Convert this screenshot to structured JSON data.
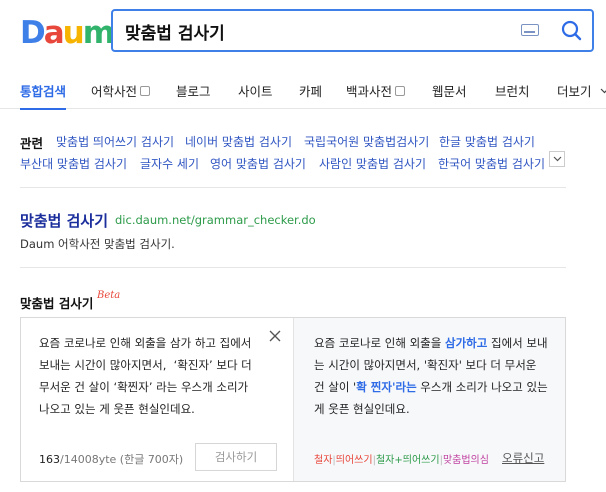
{
  "header": {
    "logo": {
      "d": "D",
      "a": "a",
      "u": "u",
      "m": "m"
    },
    "search_value": "맞춤법 검사기"
  },
  "tabs": [
    {
      "label": "통합검색",
      "active": true
    },
    {
      "label": "어학사전",
      "checkbox": true
    },
    {
      "label": "블로그"
    },
    {
      "label": "사이트"
    },
    {
      "label": "카페"
    },
    {
      "label": "백과사전",
      "checkbox": true
    },
    {
      "label": "웹문서"
    },
    {
      "label": "브런치"
    },
    {
      "label": "더보기"
    }
  ],
  "related": {
    "label": "관련",
    "row1": [
      "맞춤법 띄어쓰기 검사기",
      "네이버 맞춤법 검사기",
      "국립국어원 맞춤법검사기",
      "한글 맞춤법 검사기"
    ],
    "row2": [
      "부산대 맞춤법 검사기",
      "글자수 세기",
      "영어 맞춤법 검사기",
      "사람인 맞춤법 검사기",
      "한국어 맞춤법 검사기"
    ]
  },
  "result": {
    "title": "맞춤법 검사기",
    "url": "dic.daum.net/grammar_checker.do",
    "desc": "Daum 어학사전 맞춤법 검사기."
  },
  "checker": {
    "title": "맞춤법 검사기",
    "beta": "Beta",
    "input_text": "요즘 코로나로 인해 외출을 삼가 하고 집에서 보내는 시간이 많아지면서,  ‘확진자’ 보다 더 무서운 건 살이 ‘확찐자’ 라는 우스개 소리가 나오고 있는 게 웃픈 현실인데요.",
    "count": "163",
    "count_rest": "/14008yte (한글 700자)",
    "check_button": "검사하기",
    "output": {
      "p1": "요즘 코로나로 인해 외출을 ",
      "hl1": "삼가하고",
      "p2": " 집에서 보내는 시간이 많아지면서, '확진자' 보다 더 무서운 건 살이 '",
      "hl2": "확 찐자'라는",
      "p3": " 우스개 소리가 나오고 있는 게 웃픈 현실인데요."
    },
    "legend": {
      "a": "철자",
      "b": "띄어쓰기",
      "c": "철자+띄어쓰기",
      "d": "맞춤법의심"
    },
    "report": "오류신고"
  }
}
